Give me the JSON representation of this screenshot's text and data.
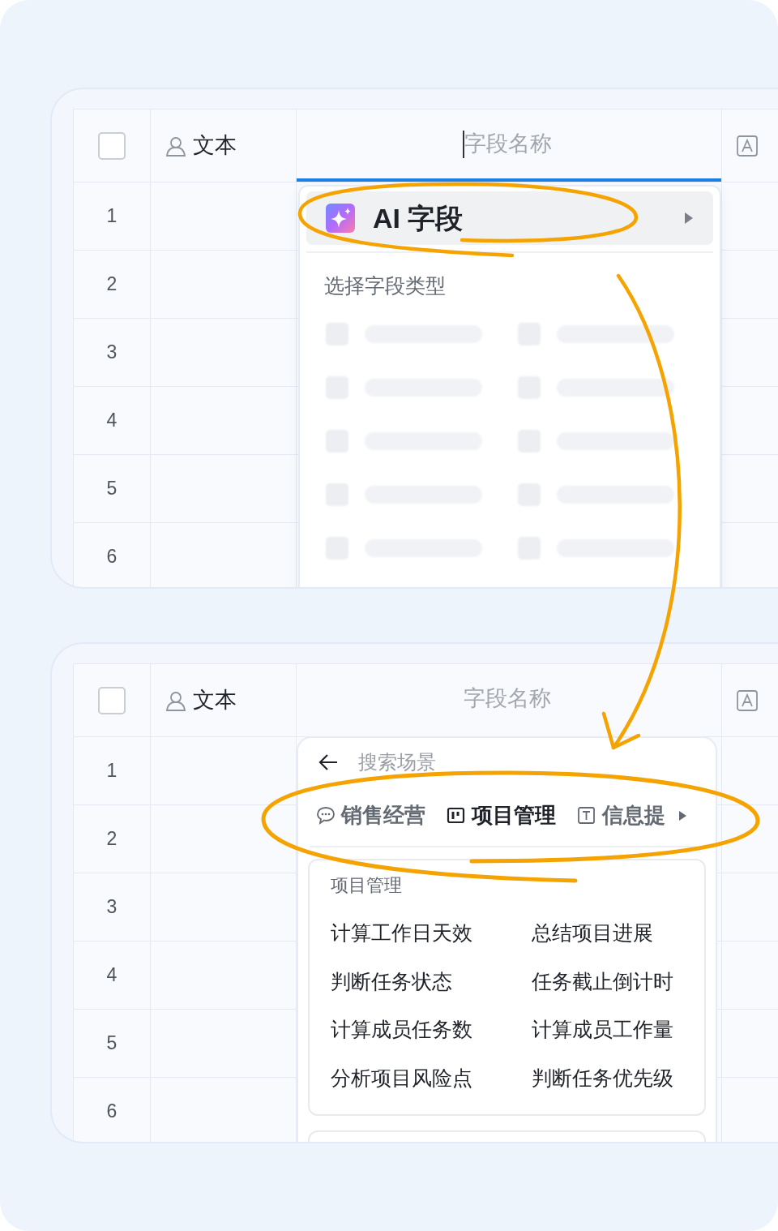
{
  "panels": [
    {
      "columns": [
        {
          "kind": "checkbox",
          "checked": false
        },
        {
          "kind": "person",
          "label": "文本"
        },
        {
          "kind": "new_field",
          "placeholder": "字段名称",
          "focused": true
        },
        {
          "kind": "text"
        }
      ],
      "row_numbers": [
        "1",
        "2",
        "3",
        "4",
        "5",
        "6"
      ],
      "menu": {
        "kind": "type_picker",
        "ai_item": {
          "label": "AI 字段"
        },
        "title": "选择字段类型",
        "loading": true
      }
    },
    {
      "columns": [
        {
          "kind": "checkbox",
          "checked": false
        },
        {
          "kind": "person",
          "label": "文本"
        },
        {
          "kind": "new_field",
          "placeholder": "字段名称",
          "focused": false
        },
        {
          "kind": "text"
        }
      ],
      "row_numbers": [
        "1",
        "2",
        "3",
        "4",
        "5",
        "6"
      ],
      "menu": {
        "kind": "scene_picker",
        "search": {
          "placeholder": "搜索场景"
        },
        "tabs": [
          {
            "label": "销售经营",
            "selected": false
          },
          {
            "label": "项目管理",
            "selected": true
          },
          {
            "label": "信息提",
            "selected": false
          }
        ],
        "group": {
          "title": "项目管理",
          "items": [
            "计算工作日天效",
            "总结项目进展",
            "判断任务状态",
            "任务截止倒计时",
            "计算成员任务数",
            "计算成员工作量",
            "分析项目风险点",
            "判断任务优先级"
          ]
        }
      }
    }
  ]
}
